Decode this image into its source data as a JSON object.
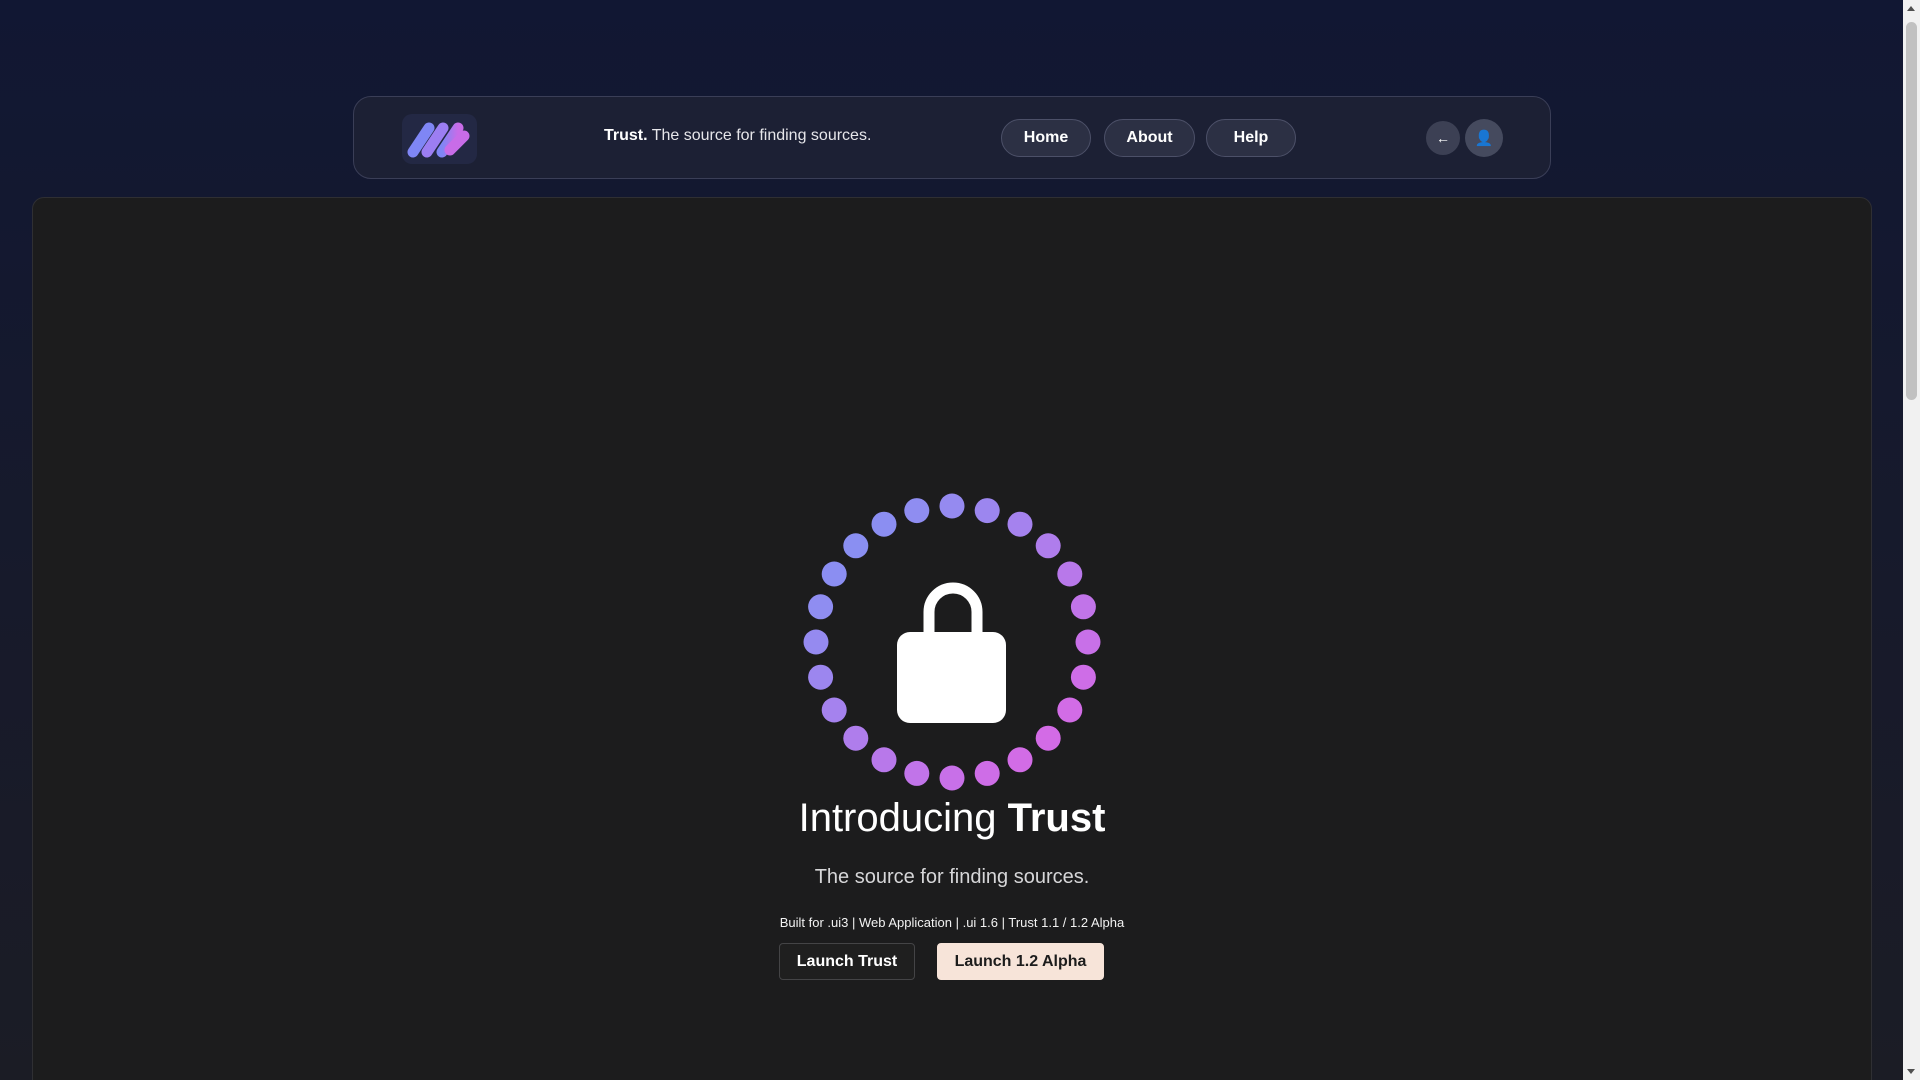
{
  "header": {
    "brand": "Trust.",
    "tagline": "The source for finding sources.",
    "nav": {
      "home": "Home",
      "about": "About",
      "help": "Help"
    },
    "back_icon": "left-arrow-icon",
    "back_glyph": "←",
    "user_icon": "user-icon",
    "user_glyph": "👤"
  },
  "hero": {
    "title_prefix": "Introducing ",
    "title_bold": "Trust",
    "subtitle": "The source for finding sources.",
    "meta": "Built for .ui3 | Web Application | .ui 1.6 | Trust 1.1 / 1.2 Alpha",
    "icon": "lock-icon",
    "launch_label": "Launch Trust",
    "alpha_label": "Launch 1.2 Alpha"
  },
  "colors": {
    "ring_start": "#8a8ff2",
    "ring_end": "#d36be6",
    "alpha_button_bg": "#f7e4d9",
    "logo_blue": "#7f86f5",
    "logo_pink": "#c86ce8"
  }
}
